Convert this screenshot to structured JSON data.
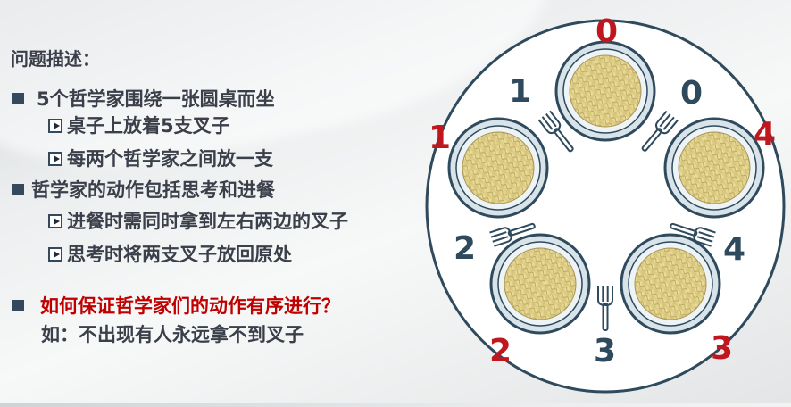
{
  "heading": "问题描述：",
  "bullets": [
    {
      "text": "5个哲学家围绕一张圆桌而坐"
    },
    {
      "text": "桌子上放着5支叉子"
    },
    {
      "text": "每两个哲学家之间放一支"
    },
    {
      "text": "哲学家的动作包括思考和进餐"
    },
    {
      "text": "进餐时需同时拿到左右两边的叉子"
    },
    {
      "text": "思考时将两支叉子放回原处"
    },
    {
      "text": "如何保证哲学家们的动作有序进行？"
    },
    {
      "text": "如：不出现有人永远拿不到叉子"
    }
  ],
  "diagram": {
    "philosopher_labels": [
      "0",
      "1",
      "2",
      "3",
      "4"
    ],
    "fork_labels": [
      "0",
      "1",
      "2",
      "3",
      "4"
    ]
  },
  "colors": {
    "text": "#3a3f4a",
    "accent_red": "#c00000",
    "number_dark": "#2e4a5c"
  }
}
